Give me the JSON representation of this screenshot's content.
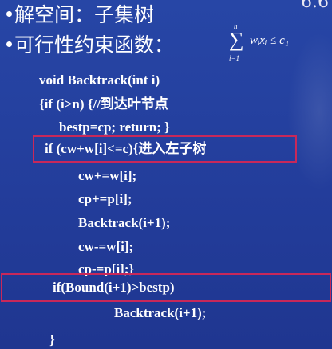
{
  "slide": {
    "corner_tag": "6.6",
    "bullets": [
      {
        "text": "解空间：子集树"
      },
      {
        "text": "可行性约束函数："
      }
    ],
    "formula": {
      "sum_upper": "n",
      "sum_lower": "i=1",
      "sigma": "∑",
      "body": "wᵢxᵢ ≤ c₁"
    },
    "code_lines": [
      "void Backtrack(int i)",
      "{if (i>n) {//到达叶节点",
      "bestp=cp;       return;  }",
      "if  (cw+w[i]<=c){进入左子树",
      "cw+=w[i];",
      "cp+=p[i];",
      "Backtrack(i+1);",
      "cw-=w[i];",
      "cp-=p[i];}",
      "if(Bound(i+1)>bestp)",
      "Backtrack(i+1);",
      "}"
    ]
  }
}
